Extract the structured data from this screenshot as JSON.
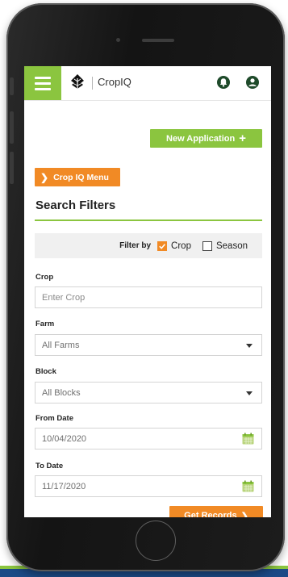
{
  "app": {
    "name": "CropIQ",
    "brand_color": "#8bc53f",
    "accent_color": "#f18a25",
    "nav_icons": [
      "menu-icon",
      "notification-icon",
      "user-icon"
    ]
  },
  "actions": {
    "new_application": "New Application",
    "crop_iq_menu": "Crop IQ Menu",
    "get_records": "Get Records"
  },
  "search_filters": {
    "title": "Search Filters",
    "filter_by_label": "Filter by",
    "options": [
      {
        "label": "Crop",
        "checked": true
      },
      {
        "label": "Season",
        "checked": false
      }
    ]
  },
  "fields": {
    "crop": {
      "label": "Crop",
      "placeholder": "Enter Crop",
      "value": ""
    },
    "farm": {
      "label": "Farm",
      "value": "All Farms"
    },
    "block": {
      "label": "Block",
      "value": "All Blocks"
    },
    "from_date": {
      "label": "From Date",
      "value": "10/04/2020"
    },
    "to_date": {
      "label": "To Date",
      "value": "11/17/2020"
    }
  }
}
